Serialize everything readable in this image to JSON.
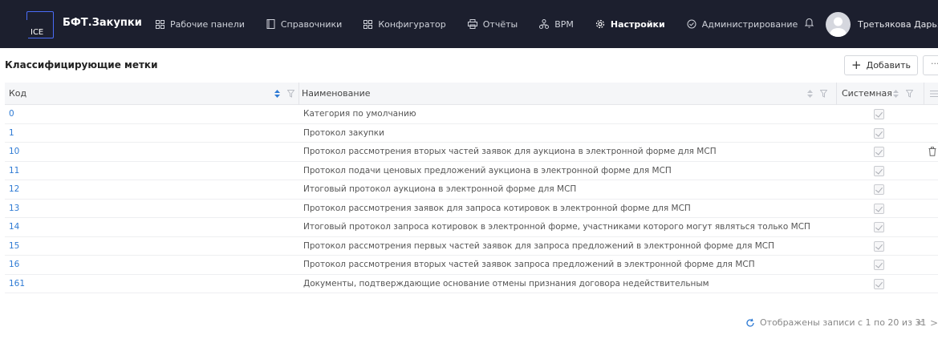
{
  "app": {
    "logo_text": "ICE",
    "brand": "БФТ.Закупки"
  },
  "nav": {
    "items": [
      {
        "label": "Рабочие панели",
        "icon": "grid-icon"
      },
      {
        "label": "Справочники",
        "icon": "book-icon"
      },
      {
        "label": "Конфигуратор",
        "icon": "grid-icon"
      },
      {
        "label": "Отчёты",
        "icon": "printer-icon"
      },
      {
        "label": "ВРМ",
        "icon": "org-chart-icon"
      },
      {
        "label": "Настройки",
        "icon": "gear-icon",
        "active": true
      },
      {
        "label": "Администрирование",
        "icon": "shield-check-icon"
      }
    ],
    "user_name": "Третьякова Дарья"
  },
  "page": {
    "title": "Классифицирующие метки",
    "add_label": "Добавить",
    "more_label": "···"
  },
  "table": {
    "columns": {
      "code": "Код",
      "name": "Наименование",
      "system": "Системная"
    },
    "rows": [
      {
        "code": "0",
        "name": "Категория по умолчанию",
        "system": true
      },
      {
        "code": "1",
        "name": "Протокол закупки",
        "system": true
      },
      {
        "code": "10",
        "name": "Протокол рассмотрения вторых частей заявок для аукциона в электронной форме для МСП",
        "system": true
      },
      {
        "code": "11",
        "name": "Протокол подачи ценовых предложений аукциона в электронной форме для МСП",
        "system": true
      },
      {
        "code": "12",
        "name": "Итоговый протокол аукциона в электронной форме для МСП",
        "system": true
      },
      {
        "code": "13",
        "name": "Протокол рассмотрения заявок для запроса котировок в электронной форме для МСП",
        "system": true
      },
      {
        "code": "14",
        "name": "Итоговый протокол запроса котировок в электронной форме, участниками которого могут являться только МСП",
        "system": true
      },
      {
        "code": "15",
        "name": "Протокол рассмотрения первых частей заявок для запроса предложений в электронной форме для МСП",
        "system": true
      },
      {
        "code": "16",
        "name": "Протокол рассмотрения вторых частей заявок запроса предложений в электронной форме для МСП",
        "system": true
      },
      {
        "code": "161",
        "name": "Документы, подтверждающие основание отмены признания договора недействительным",
        "system": true
      }
    ]
  },
  "footer": {
    "status": "Отображены записи с 1 по 20 из 31",
    "prev": "<",
    "next": ">"
  },
  "colors": {
    "topbar": "#1c1f2e",
    "link": "#2f7bd4",
    "sort_active": "#2f7bd4"
  }
}
